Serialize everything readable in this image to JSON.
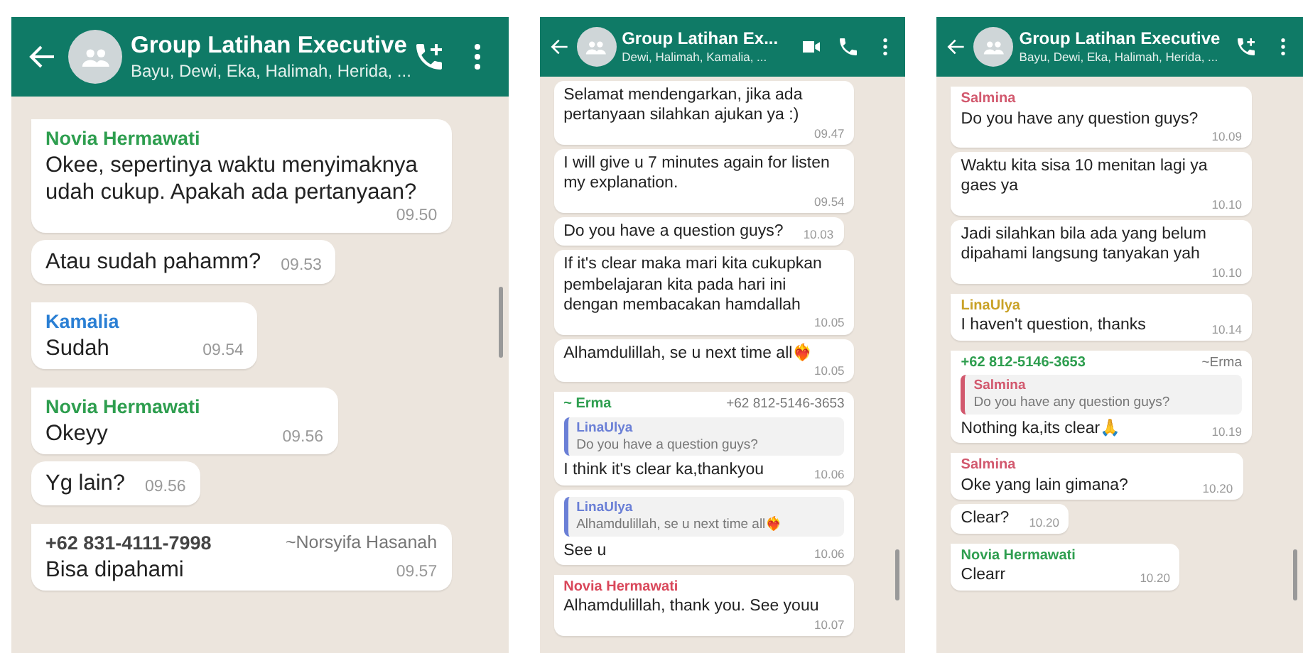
{
  "panels": [
    {
      "kind": "large",
      "header": {
        "title": "Group Latihan Executive",
        "subtitle": "Bayu, Dewi, Eka, Halimah, Herida, ...",
        "actions": [
          {
            "kind": "call-add"
          },
          {
            "kind": "more"
          }
        ]
      },
      "messages": [
        {
          "sender": {
            "name": "Novia Hermawati",
            "color": "#2e9e4f"
          },
          "tail": true,
          "text": "Okee, sepertinya waktu menyimaknya udah cukup. Apakah ada pertanyaan?",
          "time": "09.50"
        },
        {
          "tail": false,
          "text": "Atau sudah pahamm?",
          "time": "09.53"
        },
        {
          "sender": {
            "name": "Kamalia",
            "color": "#2a7fd4"
          },
          "tail": true,
          "text": "Sudah",
          "time": "09.54"
        },
        {
          "sender": {
            "name": "Novia Hermawati",
            "color": "#2e9e4f"
          },
          "tail": true,
          "text": "Okeyy",
          "time": "09.56"
        },
        {
          "tail": false,
          "text": "Yg lain?",
          "time": "09.56"
        },
        {
          "sender": {
            "name": "+62 831-4111-7998",
            "color": "#444444",
            "note": "~Norsyifa Hasanah"
          },
          "tail": true,
          "text": "Bisa dipahami",
          "time": "09.57"
        }
      ]
    },
    {
      "kind": "small",
      "header": {
        "title": "Group Latihan Ex...",
        "subtitle": "Dewi, Halimah, Kamalia, ...",
        "actions": [
          {
            "kind": "video"
          },
          {
            "kind": "call"
          },
          {
            "kind": "more"
          }
        ]
      },
      "messages": [
        {
          "tail": false,
          "text": "Selamat mendengarkan, jika ada pertanyaan silahkan ajukan ya :)",
          "time": "09.47"
        },
        {
          "tail": false,
          "text": "I will give u 7 minutes again for listen my explanation.",
          "time": "09.54"
        },
        {
          "tail": false,
          "text": "Do you have a question guys?",
          "time": "10.03"
        },
        {
          "tail": false,
          "text": "If it's clear maka mari kita cukupkan pembelajaran kita pada hari ini dengan membacakan hamdallah",
          "time": "10.05"
        },
        {
          "tail": false,
          "text": "Alhamdulillah, se u next time all❤️‍🔥",
          "time": "10.05"
        },
        {
          "sender": {
            "name": "~ Erma",
            "color": "#2e9e4f",
            "note": "+62 812-5146-3653"
          },
          "tail": true,
          "quote": {
            "name": "LinaUlya",
            "text": "Do you have a question guys?",
            "color": "#6a7fd6"
          },
          "text": "I think it's clear ka,thankyou",
          "time": "10.06"
        },
        {
          "tail": false,
          "quote": {
            "name": "LinaUlya",
            "text": "Alhamdulillah, se u next time all❤️‍🔥",
            "color": "#6a7fd6"
          },
          "text": "See u",
          "time": "10.06"
        },
        {
          "sender": {
            "name": "Novia Hermawati",
            "color": "#d9475a"
          },
          "tail": true,
          "text": "Alhamdulillah, thank you. See youu",
          "time": "10.07"
        }
      ]
    },
    {
      "kind": "small",
      "header": {
        "title": "Group Latihan Executive",
        "subtitle": "Bayu, Dewi, Eka, Halimah, Herida, ...",
        "actions": [
          {
            "kind": "call-add"
          },
          {
            "kind": "more"
          }
        ]
      },
      "messages": [
        {
          "sender": {
            "name": "Salmina",
            "color": "#d2596e"
          },
          "tail": true,
          "text": "Do you have any question guys?",
          "time": "10.09"
        },
        {
          "tail": false,
          "text": "Waktu kita sisa 10 menitan lagi ya gaes ya",
          "time": "10.10"
        },
        {
          "tail": false,
          "text": "Jadi silahkan bila ada yang belum dipahami langsung tanyakan yah",
          "time": "10.10"
        },
        {
          "sender": {
            "name": "LinaUlya",
            "color": "#c9a227"
          },
          "tail": true,
          "text": "I haven't question, thanks",
          "time": "10.14"
        },
        {
          "sender": {
            "name": "+62 812-5146-3653",
            "color": "#2e9e4f",
            "note": "~Erma"
          },
          "tail": true,
          "quote": {
            "name": "Salmina",
            "text": "Do you have any question guys?",
            "color": "#d2596e"
          },
          "text": "Nothing ka,its clear🙏",
          "time": "10.19"
        },
        {
          "sender": {
            "name": "Salmina",
            "color": "#d2596e"
          },
          "tail": true,
          "text": "Oke yang lain gimana?",
          "time": "10.20"
        },
        {
          "tail": false,
          "text": "Clear?",
          "time": "10.20"
        },
        {
          "sender": {
            "name": "Novia Hermawati",
            "color": "#2e9e4f"
          },
          "tail": true,
          "text": "Clearr",
          "time": "10.20"
        }
      ]
    }
  ]
}
